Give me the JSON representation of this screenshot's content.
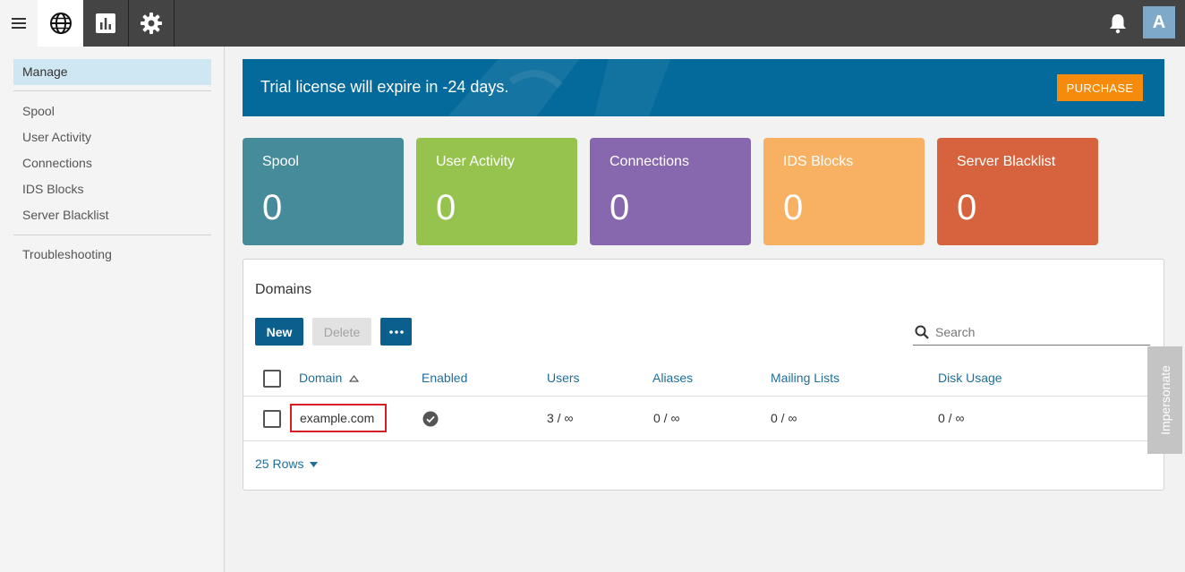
{
  "topbar": {
    "avatar_initial": "A",
    "tabs": [
      {
        "icon": "globe-icon",
        "active": true
      },
      {
        "icon": "bar-chart-icon",
        "active": false
      },
      {
        "icon": "gear-icon",
        "active": false
      }
    ]
  },
  "sidebar": {
    "manage": "Manage",
    "items": [
      "Spool",
      "User Activity",
      "Connections",
      "IDS Blocks",
      "Server Blacklist"
    ],
    "troubleshooting": "Troubleshooting"
  },
  "banner": {
    "message": "Trial license will expire in -24 days.",
    "purchase_label": "PURCHASE"
  },
  "cards": [
    {
      "title": "Spool",
      "value": "0",
      "color": "#458b99"
    },
    {
      "title": "User Activity",
      "value": "0",
      "color": "#95c34e"
    },
    {
      "title": "Connections",
      "value": "0",
      "color": "#8767ad"
    },
    {
      "title": "IDS Blocks",
      "value": "0",
      "color": "#f8b163"
    },
    {
      "title": "Server Blacklist",
      "value": "0",
      "color": "#d6633d"
    }
  ],
  "domains": {
    "title": "Domains",
    "new_label": "New",
    "delete_label": "Delete",
    "search_placeholder": "Search",
    "columns": [
      "Domain",
      "Enabled",
      "Users",
      "Aliases",
      "Mailing Lists",
      "Disk Usage"
    ],
    "rows": [
      {
        "domain": "example.com",
        "enabled": true,
        "users": "3 / ∞",
        "aliases": "0 / ∞",
        "mailing_lists": "0 / ∞",
        "disk_usage": "0 / ∞"
      }
    ],
    "rows_per_page": "25 Rows"
  },
  "impersonate_label": "Impersonate",
  "colors": {
    "accent": "#0a5f8c",
    "banner": "#046a9b",
    "purchase": "#f58a0b",
    "highlight_border": "#d61f26"
  }
}
